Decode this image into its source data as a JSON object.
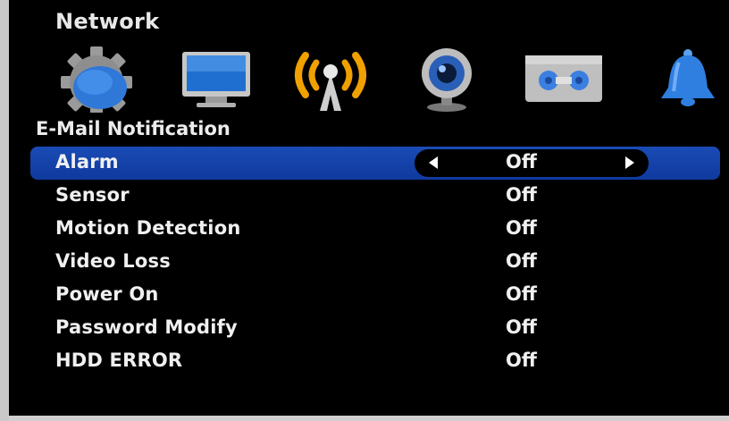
{
  "header": {
    "title": "Network"
  },
  "category_icons": [
    {
      "name": "gear-icon"
    },
    {
      "name": "monitor-icon"
    },
    {
      "name": "wireless-antenna-icon"
    },
    {
      "name": "webcam-icon"
    },
    {
      "name": "recorder-icon"
    },
    {
      "name": "bell-icon"
    }
  ],
  "section": {
    "title": "E-Mail Notification"
  },
  "settings": [
    {
      "label": "Alarm",
      "value": "Off",
      "selected": true
    },
    {
      "label": "Sensor",
      "value": "Off"
    },
    {
      "label": "Motion Detection",
      "value": "Off"
    },
    {
      "label": "Video Loss",
      "value": "Off"
    },
    {
      "label": "Power On",
      "value": "Off"
    },
    {
      "label": "Password Modify",
      "value": "Off"
    },
    {
      "label": "HDD ERROR",
      "value": "Off"
    }
  ],
  "colors": {
    "selection_bar": "#1a4bb5",
    "background": "#000000",
    "text": "#f0f0f0",
    "wireless_accent": "#f0a000"
  }
}
